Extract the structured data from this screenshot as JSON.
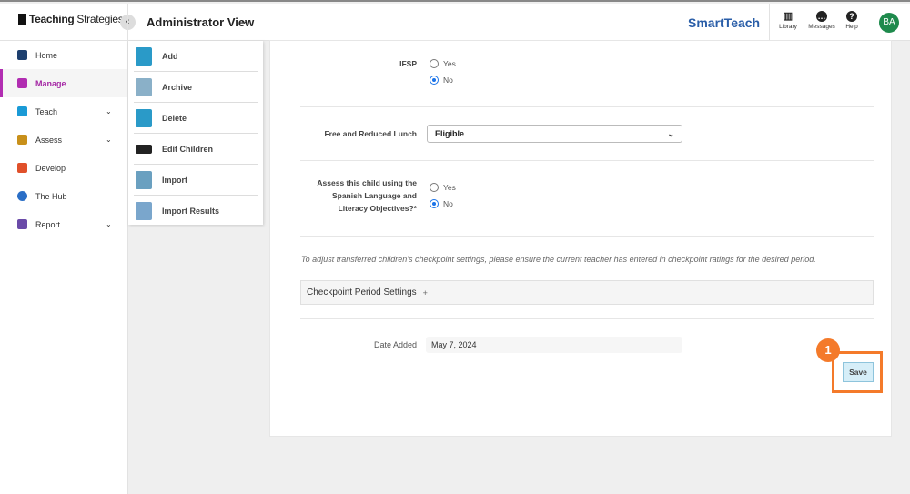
{
  "header": {
    "logo_text_bold": "Teaching",
    "logo_text_light": "Strategies",
    "view": "Administrator View",
    "brand": "SmartTeach",
    "icons": [
      {
        "label": "Library",
        "icon": "library-icon"
      },
      {
        "label": "Messages",
        "icon": "messages-icon"
      },
      {
        "label": "Help",
        "icon": "help-icon"
      }
    ],
    "avatar": "BA"
  },
  "sidebar": {
    "items": [
      {
        "label": "Home",
        "color": "#1d3f6e"
      },
      {
        "label": "Manage",
        "color": "#b12db1",
        "active": true
      },
      {
        "label": "Teach",
        "color": "#1a9ad6",
        "chevron": true
      },
      {
        "label": "Assess",
        "color": "#c8901a",
        "chevron": true
      },
      {
        "label": "Develop",
        "color": "#e0502a"
      },
      {
        "label": "The Hub",
        "color": "#2a6ec6"
      },
      {
        "label": "Report",
        "color": "#6a4aa8",
        "chevron": true
      }
    ]
  },
  "submenu": {
    "items": [
      {
        "label": "Add",
        "color": "#2a9ac8"
      },
      {
        "label": "Archive",
        "color": "#8ab0c8"
      },
      {
        "label": "Delete",
        "color": "#2a9ac8"
      },
      {
        "label": "Edit Children",
        "color": "#222"
      },
      {
        "label": "Import",
        "color": "#6aa0c0"
      },
      {
        "label": "Import Results",
        "color": "#7aa6cc"
      }
    ]
  },
  "form": {
    "ifsp": {
      "label": "IFSP",
      "options": [
        "Yes",
        "No"
      ],
      "selected": "No"
    },
    "lunch": {
      "label": "Free and Reduced Lunch",
      "value": "Eligible"
    },
    "spanish": {
      "label_lines": [
        "Assess this child using the",
        "Spanish Language and",
        "Literacy Objectives?*"
      ],
      "options": [
        "Yes",
        "No"
      ],
      "selected": "No"
    },
    "note": "To adjust transferred children's checkpoint settings, please ensure the current teacher has entered in checkpoint ratings for the desired period.",
    "checkpoint": "Checkpoint Period Settings",
    "checkpoint_plus": "+",
    "date_label": "Date Added",
    "date_value": "May 7, 2024",
    "save": "Save"
  },
  "annotation": {
    "step": "1",
    "color": "#f47a2a"
  }
}
